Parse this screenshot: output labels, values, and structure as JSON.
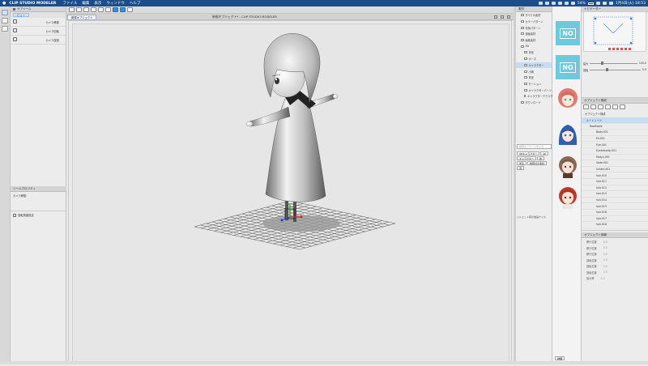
{
  "menubar": {
    "apple_icon": "apple-icon",
    "app_name": "CLIP STUDIO MODELER",
    "items": [
      "ファイル",
      "編集",
      "表示",
      "ウィンドウ",
      "ヘルプ"
    ],
    "battery": "54%",
    "datetime": "1月4日(火) 18:53"
  },
  "window": {
    "title": "新規オブジェクト* - CLIP STUDIO MODELER",
    "doc_tab": "新規オブジェクト"
  },
  "subtool": {
    "panel_title": "サブツール",
    "tab": "ビュー",
    "items": [
      "カメラ移動",
      "カメラ回転",
      "カメラ旋回"
    ]
  },
  "tool_property": {
    "title": "ツールプロパティ",
    "subtitle": "カメラ移動",
    "checkbox_label": "回転角度指定"
  },
  "material": {
    "panel_title": "素材",
    "tree": [
      {
        "label": "すべての素材",
        "selected": false,
        "indent": false
      },
      {
        "label": "カラーパターン",
        "selected": false,
        "indent": false
      },
      {
        "label": "背景パターン",
        "selected": false,
        "indent": false
      },
      {
        "label": "漫画素材",
        "selected": false,
        "indent": false
      },
      {
        "label": "画像素材",
        "selected": false,
        "indent": false
      },
      {
        "label": "3D",
        "selected": false,
        "indent": false
      },
      {
        "label": "背景",
        "selected": false,
        "indent": true
      },
      {
        "label": "ポーズ",
        "selected": false,
        "indent": true
      },
      {
        "label": "キャラクター",
        "selected": true,
        "indent": true
      },
      {
        "label": "小物",
        "selected": false,
        "indent": true
      },
      {
        "label": "背景",
        "selected": false,
        "indent": true
      },
      {
        "label": "モーション",
        "selected": false,
        "indent": true
      },
      {
        "label": "キャラクターパーツ",
        "selected": false,
        "indent": true
      },
      {
        "label": "キャラクターテクスチャ",
        "selected": false,
        "indent": true
      },
      {
        "label": "ダウンロード",
        "selected": false,
        "indent": false
      }
    ],
    "search_placeholder": "検索キーワードを入力",
    "tags": [
      "3Dキャラクター",
      "3D",
      "キャラクター",
      "体",
      "学生",
      "制限付き素材",
      "頭"
    ],
    "status_label": "シルエット時の描画サイズ",
    "bottom_button": "詳細"
  },
  "navigator": {
    "title": "ナビゲーター",
    "zoom_label": "拡大",
    "zoom_value": "100.0",
    "rotate_label": "回転",
    "rotate_value": "0.0"
  },
  "object_tree": {
    "panel_title": "オブジェクト構成",
    "header_label": "オブジェクト構成",
    "rows": [
      {
        "label": "ルートノード",
        "type": "sel"
      },
      {
        "label": "RootNode",
        "type": "root"
      },
      {
        "label": "Body.001",
        "type": "child"
      },
      {
        "label": "Ell.001",
        "type": "child"
      },
      {
        "label": "Eye.001",
        "type": "child"
      },
      {
        "label": "EyebrowUp.001",
        "type": "child"
      },
      {
        "label": "Matyu.001",
        "type": "child"
      },
      {
        "label": "Sode.001",
        "type": "child"
      },
      {
        "label": "Unider.001",
        "type": "child"
      },
      {
        "label": "hair.010",
        "type": "child"
      },
      {
        "label": "hair.011",
        "type": "child"
      },
      {
        "label": "hair.012",
        "type": "child"
      },
      {
        "label": "hair.013",
        "type": "child"
      },
      {
        "label": "hair.014",
        "type": "child"
      },
      {
        "label": "hair.015",
        "type": "child"
      },
      {
        "label": "hair.016",
        "type": "child"
      },
      {
        "label": "hair.017",
        "type": "child"
      },
      {
        "label": "hair.018",
        "type": "child"
      }
    ]
  },
  "object_property": {
    "title": "オブジェクト情報",
    "rows": [
      {
        "label": "移行位置",
        "value": "0.0"
      },
      {
        "label": "移行位置",
        "value": "0.0"
      },
      {
        "label": "移行位置",
        "value": "0.0"
      },
      {
        "label": "回転位置",
        "value": "0.0"
      },
      {
        "label": "回転位置",
        "value": "0.0"
      },
      {
        "label": "回転位置",
        "value": "0.0"
      },
      {
        "label": "拡大率",
        "value": "1.0"
      }
    ]
  },
  "colors": {
    "menubar": "#1b4d8a",
    "selection": "#c6dcf3",
    "no_thumb": "#6fc9dd",
    "grid": "#555555",
    "axis_x": "#dd2222",
    "axis_y": "#22aa22",
    "axis_z": "#2244dd"
  },
  "thumbnails": [
    "no-thumbnail",
    "no-thumbnail",
    "character-pink",
    "character-blue",
    "character-brown",
    "character-red"
  ]
}
